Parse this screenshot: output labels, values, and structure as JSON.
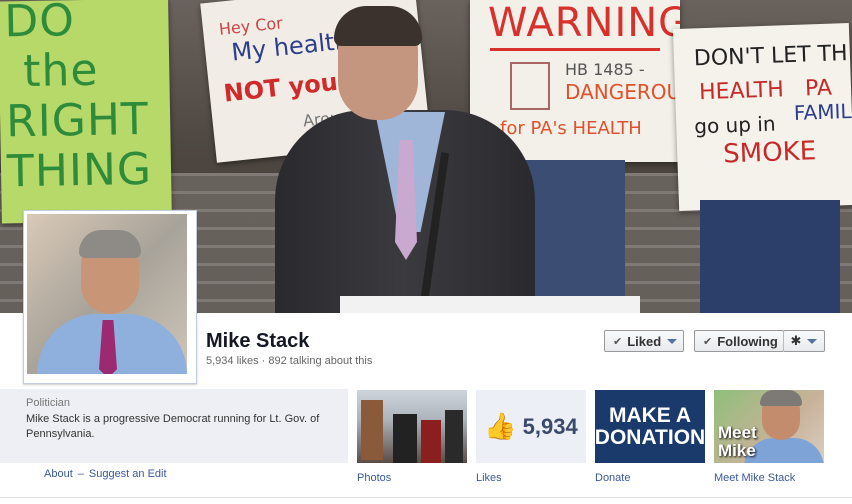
{
  "cover": {
    "signs": {
      "green": [
        "DO",
        "the",
        "RIGHT",
        "THING"
      ],
      "white1": [
        "Hey Cor",
        "My health",
        "NOT your",
        "Arou"
      ],
      "warning": {
        "title": "WARNING",
        "line1": "HB 1485 -",
        "line2": "DANGEROU",
        "line3": "for PA's HEALTH"
      },
      "right": {
        "line1": "DON'T LET TH",
        "line2": "HEALTH",
        "line2b": "PA",
        "line3": "go up in",
        "line4": "SMOKE",
        "extra": "FAMIL"
      }
    }
  },
  "profile": {
    "name": "Mike Stack",
    "stats": "5,934 likes · 892 talking about this"
  },
  "buttons": {
    "liked": "Liked",
    "following": "Following"
  },
  "about": {
    "category": "Politician",
    "description": "Mike Stack is a progressive Democrat running for Lt. Gov. of Pennsylvania.",
    "link_about": "About",
    "link_sep": "–",
    "link_suggest": "Suggest an Edit"
  },
  "tiles": {
    "photos": {
      "label": "Photos"
    },
    "likes": {
      "count": "5,934",
      "label": "Likes"
    },
    "donate": {
      "text_line1": "MAKE A",
      "text_line2": "DONATION",
      "label": "Donate"
    },
    "meet": {
      "text_line1": "Meet",
      "text_line2": "Mike",
      "label": "Meet Mike Stack"
    }
  },
  "icons": {
    "check": "check-icon",
    "caret": "caret-down-icon",
    "gear": "gear-icon",
    "thumbs_up": "thumbs-up-icon"
  },
  "colors": {
    "link": "#3b5998",
    "donate_bg": "#1a3a6b",
    "about_bg": "#edeff4"
  }
}
